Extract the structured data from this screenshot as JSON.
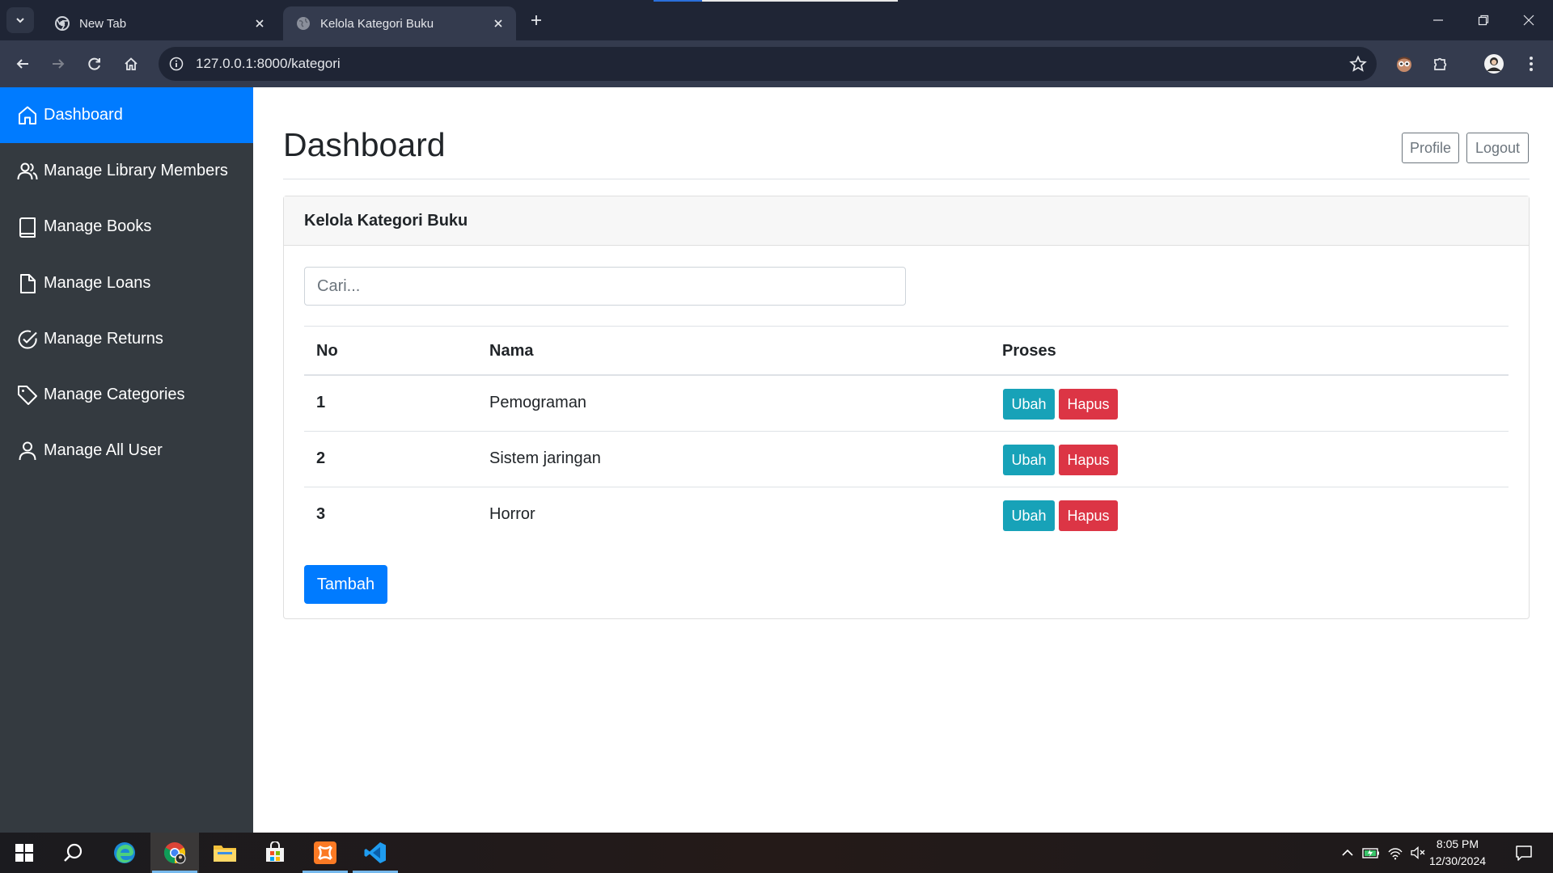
{
  "browser": {
    "tabs": [
      {
        "title": "New Tab",
        "icon": "chrome-icon",
        "active": false
      },
      {
        "title": "Kelola Kategori Buku",
        "icon": "globe-icon",
        "active": true
      }
    ],
    "url": "127.0.0.1:8000/kategori",
    "colors": {
      "frame": "#1f2535",
      "toolbar": "#343b4e"
    }
  },
  "sidebar": {
    "items": [
      {
        "label": "Dashboard",
        "icon": "home-icon",
        "active": true
      },
      {
        "label": "Manage Library Members",
        "icon": "users-icon"
      },
      {
        "label": "Manage Books",
        "icon": "book-icon"
      },
      {
        "label": "Manage Loans",
        "icon": "file-icon"
      },
      {
        "label": "Manage Returns",
        "icon": "check-circle-icon"
      },
      {
        "label": "Manage Categories",
        "icon": "tag-icon"
      },
      {
        "label": "Manage All User",
        "icon": "user-icon"
      }
    ],
    "colors": {
      "background": "#343a40",
      "active": "#007bff"
    }
  },
  "header": {
    "title": "Dashboard",
    "profile_label": "Profile",
    "logout_label": "Logout"
  },
  "card": {
    "title": "Kelola Kategori Buku",
    "search_placeholder": "Cari...",
    "columns": {
      "no": "No",
      "nama": "Nama",
      "proses": "Proses"
    },
    "rows": [
      {
        "no": "1",
        "nama": "Pemograman",
        "edit": "Ubah",
        "delete": "Hapus"
      },
      {
        "no": "2",
        "nama": "Sistem jaringan",
        "edit": "Ubah",
        "delete": "Hapus"
      },
      {
        "no": "3",
        "nama": "Horror",
        "edit": "Ubah",
        "delete": "Hapus"
      }
    ],
    "add_label": "Tambah",
    "colors": {
      "primary": "#007bff",
      "info": "#17a2b8",
      "danger": "#dc3545"
    }
  },
  "taskbar": {
    "apps": [
      "windows-start-icon",
      "search-icon",
      "edge-icon",
      "chrome-icon",
      "file-explorer-icon",
      "microsoft-store-icon",
      "xampp-icon",
      "vscode-icon"
    ],
    "time": "8:05 PM",
    "date": "12/30/2024"
  }
}
